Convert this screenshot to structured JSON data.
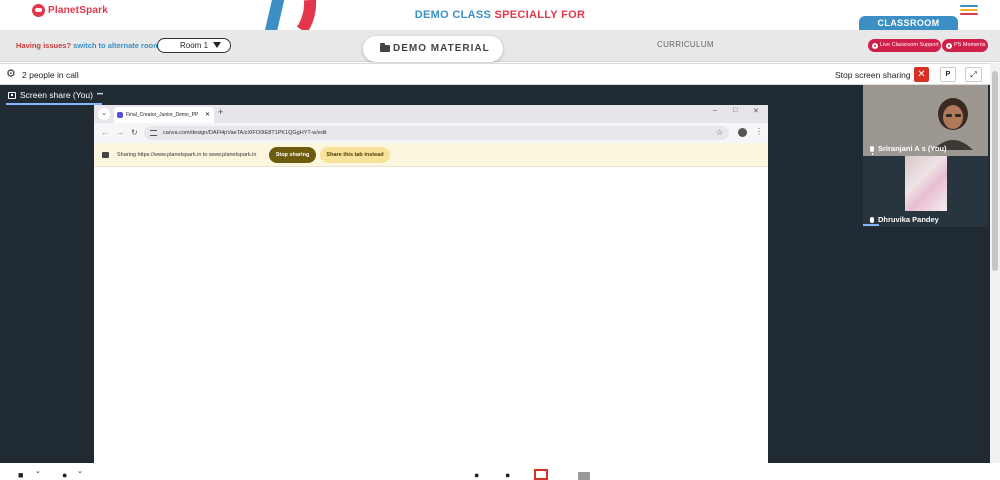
{
  "brand": {
    "logo_text": "PlanetSpark",
    "title_part1": "DEMO CLASS ",
    "title_part2": "SPECIALLY FOR"
  },
  "colors": {
    "accent_blue": "#3b8fc4",
    "accent_red": "#e2364b",
    "pill_red": "#d21f4a",
    "meet_dark": "#1f2a33"
  },
  "tabs": {
    "classroom": "CLASSROOM"
  },
  "subbar": {
    "issues_question": "Having issues?",
    "issues_link": "switch to alternate room",
    "room_value": "Room 1",
    "demo_material": "DEMO MATERIAL",
    "curriculum": "CURRICULUM",
    "live_support": "Live Classroom Support",
    "ps_moments": "PS Moments"
  },
  "meet": {
    "people_in_call": "2 people in call",
    "stop_screen_sharing": "Stop screen sharing",
    "p_button": "P",
    "share_label": "Screen share (You)",
    "more_dots": "•••"
  },
  "browser": {
    "tab_title": "Final_Creator_Junior_Demo_PP",
    "url": "canva.com/design/DAFl4pVaeTA/zXlFO0tE8T1PK1QGgHYT-w/edit",
    "sharing_message": "Sharing https://www.planetspark.in to www.planetspark.in",
    "stop_sharing": "Stop sharing",
    "share_tab_instead": "Share this tab instead"
  },
  "participants": [
    {
      "name": "Sriranjani A s (You)"
    },
    {
      "name": "Dhruvika Pandey"
    }
  ]
}
